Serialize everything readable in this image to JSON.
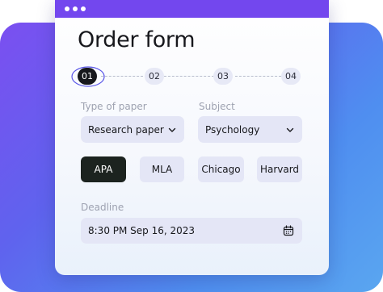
{
  "window": {
    "controls": [
      "dot",
      "dot",
      "dot"
    ]
  },
  "title": "Order form",
  "steps": [
    "01",
    "02",
    "03",
    "04"
  ],
  "active_step": "01",
  "paper": {
    "label": "Type of paper",
    "value": "Research paper"
  },
  "subject": {
    "label": "Subject",
    "value": "Psychology"
  },
  "citation_styles": [
    "APA",
    "MLA",
    "Chicago",
    "Harvard"
  ],
  "selected_style": "APA",
  "deadline": {
    "label": "Deadline",
    "value": "8:30 PM Sep 16, 2023"
  },
  "colors": {
    "accent": "#7347ee",
    "active_step": "#17181c",
    "active_button": "#1c231f",
    "field_bg": "#e4e6f6"
  },
  "icons": {
    "paper_dropdown": "chevron-down-icon",
    "subject_dropdown": "chevron-down-icon",
    "deadline": "calendar-icon"
  }
}
